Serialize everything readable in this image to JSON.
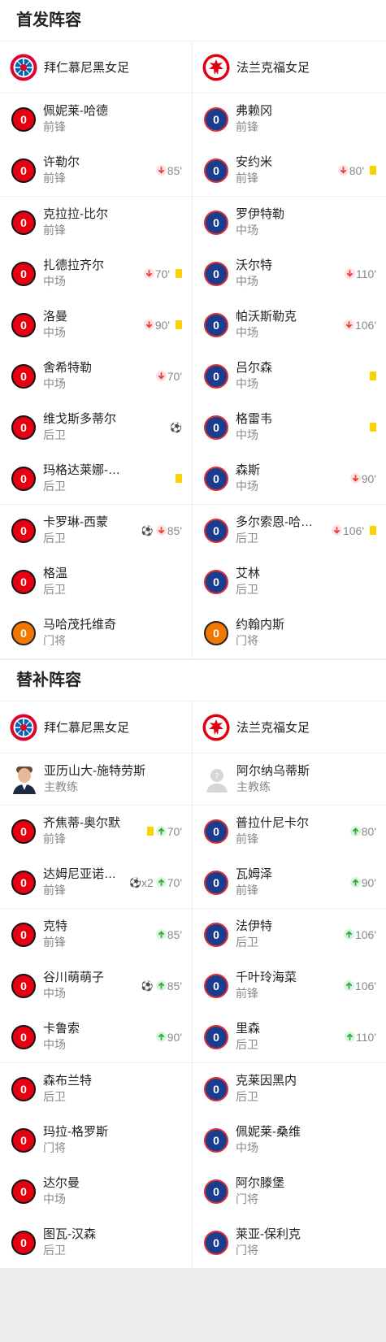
{
  "starting_title": "首发阵容",
  "subs_title": "替补阵容",
  "home_team": "拜仁慕尼黑女足",
  "away_team": "法兰克福女足",
  "starting": {
    "home": [
      {
        "num": "0",
        "name": "佩妮莱-哈德",
        "pos": "前锋",
        "events": []
      },
      {
        "num": "0",
        "name": "许勒尔",
        "pos": "前锋",
        "events": [
          {
            "t": "sub_out",
            "min": "85'"
          }
        ]
      },
      {
        "num": "0",
        "name": "克拉拉-比尔",
        "pos": "前锋",
        "events": []
      },
      {
        "num": "0",
        "name": "扎德拉齐尔",
        "pos": "中场",
        "events": [
          {
            "t": "sub_out",
            "min": "70'"
          },
          {
            "t": "yellow"
          }
        ]
      },
      {
        "num": "0",
        "name": "洛曼",
        "pos": "中场",
        "events": [
          {
            "t": "sub_out",
            "min": "90'"
          },
          {
            "t": "yellow"
          }
        ]
      },
      {
        "num": "0",
        "name": "舍希特勒",
        "pos": "中场",
        "events": [
          {
            "t": "sub_out",
            "min": "70'"
          }
        ]
      },
      {
        "num": "0",
        "name": "维戈斯多蒂尔",
        "pos": "后卫",
        "events": [
          {
            "t": "goal"
          }
        ]
      },
      {
        "num": "0",
        "name": "玛格达莱娜-…",
        "pos": "后卫",
        "events": [
          {
            "t": "yellow"
          }
        ]
      },
      {
        "num": "0",
        "name": "卡罗琳-西蒙",
        "pos": "后卫",
        "events": [
          {
            "t": "assist"
          },
          {
            "t": "sub_out",
            "min": "85'"
          }
        ]
      },
      {
        "num": "0",
        "name": "格温",
        "pos": "后卫",
        "events": []
      },
      {
        "num": "0",
        "name": "马哈茂托维奇",
        "pos": "门将",
        "events": [],
        "gk": true
      }
    ],
    "away": [
      {
        "num": "0",
        "name": "弗赖冈",
        "pos": "前锋",
        "events": []
      },
      {
        "num": "0",
        "name": "安约米",
        "pos": "前锋",
        "events": [
          {
            "t": "sub_out",
            "min": "80'"
          },
          {
            "t": "yellow"
          }
        ]
      },
      {
        "num": "0",
        "name": "罗伊特勒",
        "pos": "中场",
        "events": []
      },
      {
        "num": "0",
        "name": "沃尔特",
        "pos": "中场",
        "events": [
          {
            "t": "sub_out",
            "min": "110'"
          }
        ]
      },
      {
        "num": "0",
        "name": "帕沃斯勒克",
        "pos": "中场",
        "events": [
          {
            "t": "sub_out",
            "min": "106'"
          }
        ]
      },
      {
        "num": "0",
        "name": "吕尔森",
        "pos": "中场",
        "events": [
          {
            "t": "yellow"
          }
        ]
      },
      {
        "num": "0",
        "name": "格雷韦",
        "pos": "中场",
        "events": [
          {
            "t": "yellow"
          }
        ]
      },
      {
        "num": "0",
        "name": "森斯",
        "pos": "中场",
        "events": [
          {
            "t": "sub_out",
            "min": "90'"
          }
        ]
      },
      {
        "num": "0",
        "name": "多尔索恩-哈…",
        "pos": "后卫",
        "events": [
          {
            "t": "sub_out",
            "min": "106'"
          },
          {
            "t": "yellow"
          }
        ]
      },
      {
        "num": "0",
        "name": "艾林",
        "pos": "后卫",
        "events": []
      },
      {
        "num": "0",
        "name": "约翰内斯",
        "pos": "门将",
        "events": [],
        "gk": true
      }
    ]
  },
  "subs": {
    "home_coach": {
      "name": "亚历山大-施特劳斯",
      "role": "主教练"
    },
    "away_coach": {
      "name": "阿尔纳乌蒂斯",
      "role": "主教练"
    },
    "home": [
      {
        "num": "0",
        "name": "齐焦蒂-奥尔默",
        "pos": "前锋",
        "events": [
          {
            "t": "yellow"
          },
          {
            "t": "sub_in",
            "min": "70'"
          }
        ]
      },
      {
        "num": "0",
        "name": "达姆尼亚诺维奇",
        "pos": "前锋",
        "events": [
          {
            "t": "goal",
            "count": "x2"
          },
          {
            "t": "sub_in",
            "min": "70'"
          }
        ]
      },
      {
        "num": "0",
        "name": "克特",
        "pos": "前锋",
        "events": [
          {
            "t": "sub_in",
            "min": "85'"
          }
        ]
      },
      {
        "num": "0",
        "name": "谷川萌萌子",
        "pos": "中场",
        "events": [
          {
            "t": "goal"
          },
          {
            "t": "sub_in",
            "min": "85'"
          }
        ]
      },
      {
        "num": "0",
        "name": "卡鲁索",
        "pos": "中场",
        "events": [
          {
            "t": "sub_in",
            "min": "90'"
          }
        ]
      },
      {
        "num": "0",
        "name": "森布兰特",
        "pos": "后卫",
        "events": []
      },
      {
        "num": "0",
        "name": "玛拉-格罗斯",
        "pos": "门将",
        "events": []
      },
      {
        "num": "0",
        "name": "达尔曼",
        "pos": "中场",
        "events": []
      },
      {
        "num": "0",
        "name": "图瓦-汉森",
        "pos": "后卫",
        "events": []
      }
    ],
    "away": [
      {
        "num": "0",
        "name": "普拉什尼卡尔",
        "pos": "前锋",
        "events": [
          {
            "t": "sub_in",
            "min": "80'"
          }
        ]
      },
      {
        "num": "0",
        "name": "瓦姆泽",
        "pos": "前锋",
        "events": [
          {
            "t": "sub_in",
            "min": "90'"
          }
        ]
      },
      {
        "num": "0",
        "name": "法伊特",
        "pos": "后卫",
        "events": [
          {
            "t": "sub_in",
            "min": "106'"
          }
        ]
      },
      {
        "num": "0",
        "name": "千叶玲海菜",
        "pos": "前锋",
        "events": [
          {
            "t": "sub_in",
            "min": "106'"
          }
        ]
      },
      {
        "num": "0",
        "name": "里森",
        "pos": "后卫",
        "events": [
          {
            "t": "sub_in",
            "min": "110'"
          }
        ]
      },
      {
        "num": "0",
        "name": "克莱因黑内",
        "pos": "后卫",
        "events": []
      },
      {
        "num": "0",
        "name": "佩妮莱-桑维",
        "pos": "中场",
        "events": []
      },
      {
        "num": "0",
        "name": "阿尔滕堡",
        "pos": "门将",
        "events": []
      },
      {
        "num": "0",
        "name": "莱亚-保利克",
        "pos": "门将",
        "events": []
      }
    ]
  },
  "colors": {
    "home_num": "#e60012",
    "away_num": "#1a3d8f",
    "gk_num": "#f07800",
    "yellow_card": "#ffd000",
    "sub_out": "#e84040",
    "sub_in": "#2eaa3e"
  }
}
